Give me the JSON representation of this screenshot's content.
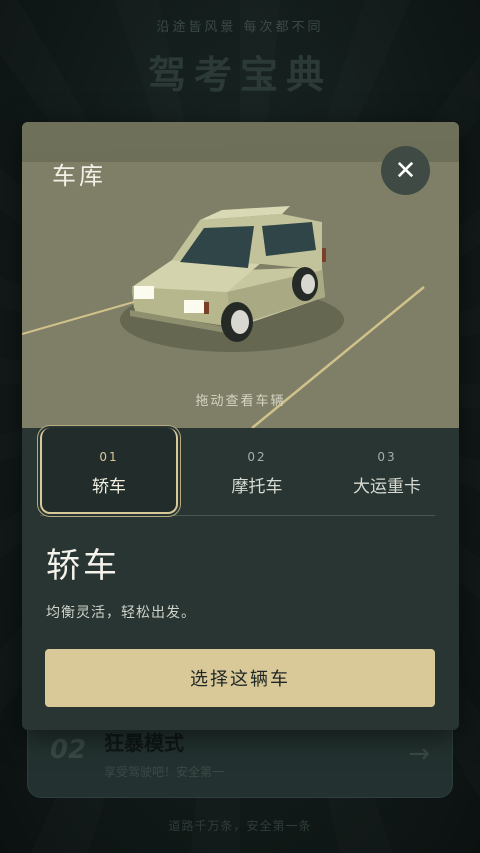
{
  "background": {
    "tagline": "沿途皆风景    每次都不同",
    "title": "驾考宝典",
    "card": {
      "number": "02",
      "title": "狂暴模式",
      "subtitle": "享受驾驶吧！安全第一",
      "arrow": "→"
    },
    "footer": "道路千万条，安全第一条"
  },
  "modal": {
    "title": "车库",
    "close_label": "✕",
    "drag_hint": "拖动查看车辆",
    "tabs": [
      {
        "number": "01",
        "label": "轿车",
        "active": true
      },
      {
        "number": "02",
        "label": "摩托车",
        "active": false
      },
      {
        "number": "03",
        "label": "大运重卡",
        "active": false
      }
    ],
    "selected": {
      "name": "轿车",
      "description": "均衡灵活，轻松出发。"
    },
    "select_button": "选择这辆车"
  },
  "colors": {
    "accent": "#d9c999",
    "modal_bg": "#283533",
    "viewport_bg": "#7e7f66"
  }
}
